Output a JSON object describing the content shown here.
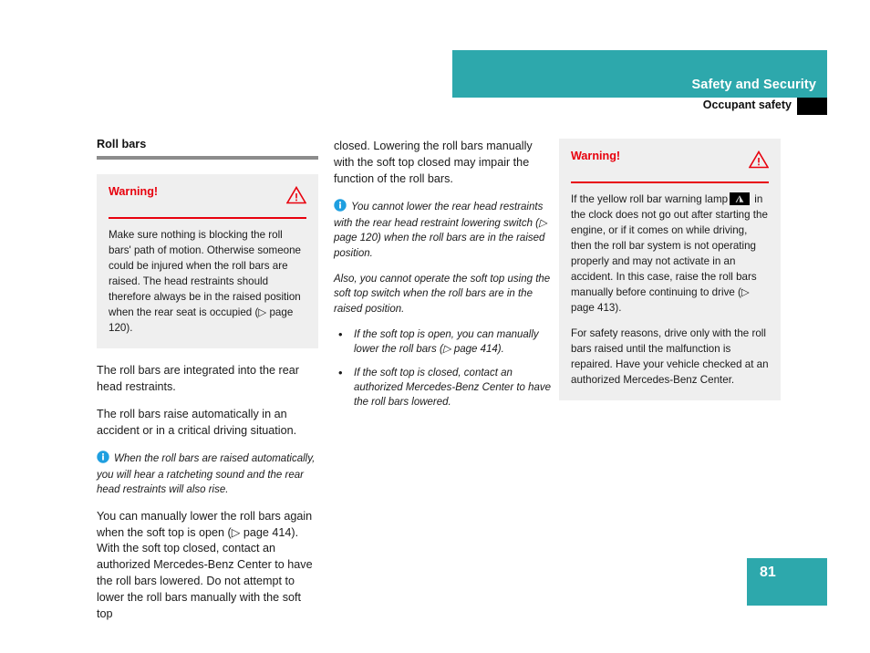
{
  "header": {
    "band_title": "Safety and Security",
    "sub_title": "Occupant safety",
    "band_color": "#2da8ac",
    "tab_color": "#000000"
  },
  "left_column": {
    "section_heading": "Roll bars",
    "warning": {
      "title": "Warning!",
      "icon": "warning-triangle-icon",
      "accent_color": "#e8000d",
      "background_color": "#efefef",
      "paragraphs": [
        "Make sure nothing is blocking the roll bars' path of motion. Otherwise someone could be injured when the roll bars are raised. The head restraints should therefore always be in the raised position when the rear seat is occupied (▷ page 120)."
      ]
    },
    "paragraphs": [
      "The roll bars are integrated into the rear head restraints.",
      "The roll bars raise automatically in an accident or in a critical driving situation."
    ],
    "note": "When the roll bars are raised automatically, you will hear a ratcheting sound and the rear head restraints will also rise.",
    "paragraph_after_note": "You can manually lower the roll bars again when the soft top is open (▷ page 414). With the soft top closed, contact an authorized Mercedes-Benz Center to have the roll bars lowered. Do not attempt to lower the roll bars manually with the soft top"
  },
  "middle_column": {
    "continuation": "closed. Lowering the roll bars manually with the soft top closed may impair the function of the roll bars.",
    "note": "You cannot lower the rear head restraints with the rear head restraint lowering switch (▷ page 120) when the roll bars are in the raised position.",
    "note_continued": "Also, you cannot operate the soft top using the soft top switch when the roll bars are in the raised position.",
    "bullets": [
      "If the soft top is open, you can manually lower the roll bars (▷ page 414).",
      "If the soft top is closed, contact an authorized Mercedes-Benz Center to have the roll bars lowered."
    ]
  },
  "right_column": {
    "warning": {
      "title": "Warning!",
      "icon": "warning-triangle-icon",
      "accent_color": "#e8000d",
      "background_color": "#efefef",
      "paragraph_1_part_1": "If the yellow roll bar warning lamp",
      "lamp_icon": "roll-bar-warning-lamp-icon",
      "paragraph_1_part_2": "in the clock does not go out after starting the engine, or if it comes on while driving, then the roll bar system is not operating properly and may not activate in an accident. In this case, raise the roll bars manually before continuing to drive (▷ page 413).",
      "paragraph_2": "For safety reasons, drive only with the roll bars raised until the malfunction is repaired. Have your vehicle checked at an authorized Mercedes-Benz Center."
    }
  },
  "footer": {
    "page_number": "81",
    "page_box_color": "#2da8ac"
  }
}
